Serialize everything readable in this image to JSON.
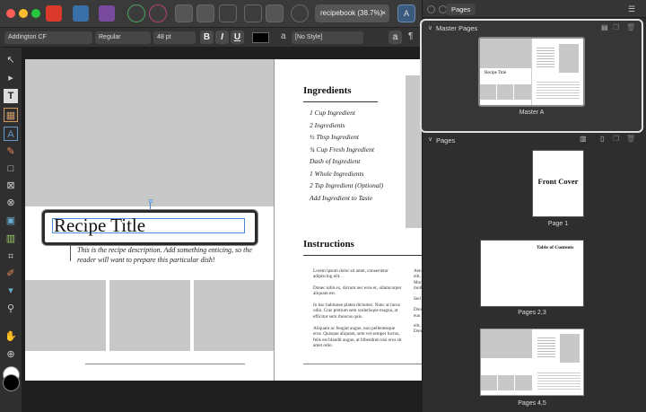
{
  "toolbar": {
    "doc_tab": "recipebook (38.7%)",
    "close_tab": "×"
  },
  "context": {
    "font_family": "Addington CF",
    "font_style": "Regular",
    "font_size": "48 pt",
    "bold": "B",
    "italic": "I",
    "underline": "U",
    "char_style_glyph": "a",
    "char_style": "[No Style]",
    "para_glyph": "a",
    "para_mark": "¶"
  },
  "page_left": {
    "title": "Recipe Title",
    "description": "This is the recipe description. Add something enticing, so the reader will want to prepare this particular dish!"
  },
  "page_right": {
    "ingredients_heading": "Ingredients",
    "ingredients": [
      "1 Cup Ingredient",
      "2 Ingredients",
      "½ Tbsp Ingredient",
      "¾ Cup Fresh Ingredient",
      "Dash of Ingredient",
      "1 Whole Ingredients",
      "2 Tsp Ingredient (Optional)",
      "Add Ingredient to Taste"
    ],
    "instructions_heading": "Instructions",
    "paragraphs": [
      "Lorem ipsum dolor sit amet, consectetur adipiscing elit.",
      "Donec nibh ex, dictum nec eros et, ullamcorper aliquam est.",
      "In hac habitasse platea dictumst. Nunc at lacus odio. Cras pretium sem scelerisque magna, at efficitur sem rhoncus quis.",
      "Aliquam ac feugiat augue, non pellentesque eros. Quisque aliquam, sem vel semper luctus, felis est blandit augue, at bibendum nisi eros sit amet odio."
    ],
    "col2": [
      "Aen",
      "elit,",
      "Mor",
      "moll",
      "Sed",
      "Don",
      "eun",
      "elit,",
      "Don"
    ]
  },
  "panel": {
    "tab": "Pages",
    "master_section": "Master Pages",
    "master_label": "Master A",
    "pages_section": "Pages",
    "pages": [
      {
        "caption": "Page 1",
        "thumb_text": "Front Cover"
      },
      {
        "caption": "Pages 2,3",
        "thumb_text": "Table of Contents"
      },
      {
        "caption": "Pages 4,5"
      }
    ],
    "thumb_title": "Recipe Title"
  }
}
